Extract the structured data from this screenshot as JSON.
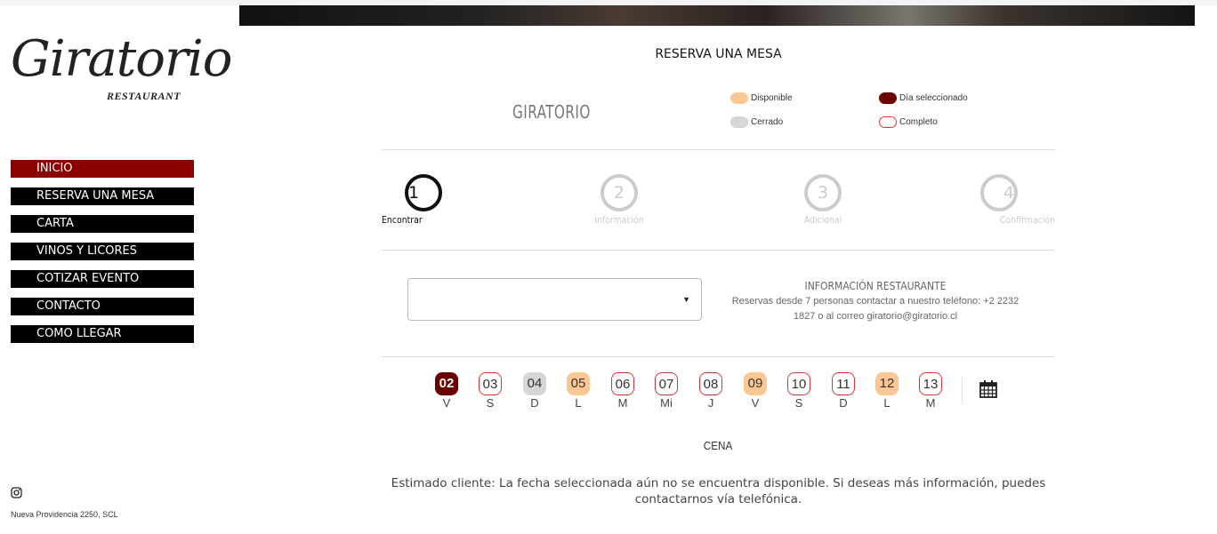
{
  "logo": {
    "script": "Giratorio",
    "subtitle": "RESTAURANT"
  },
  "nav": [
    {
      "label": "INICIO",
      "active": true
    },
    {
      "label": "RESERVA UNA MESA",
      "active": false
    },
    {
      "label": "CARTA",
      "active": false
    },
    {
      "label": "VINOS Y LICORES",
      "active": false
    },
    {
      "label": "COTIZAR EVENTO",
      "active": false
    },
    {
      "label": "CONTACTO",
      "active": false
    },
    {
      "label": "COMO LLEGAR",
      "active": false
    }
  ],
  "footer": {
    "address": "Nueva Providencia 2250, SCL",
    "social_icon": "instagram-icon"
  },
  "booking": {
    "title": "RESERVA UNA MESA",
    "restaurant_name": "GIRATORIO",
    "legend": {
      "available": "Disponible",
      "closed": "Cerrado",
      "selected": "Día seleccionado",
      "full": "Completo"
    },
    "steps": [
      {
        "num": "1",
        "label": "Encontrar"
      },
      {
        "num": "2",
        "label": "Información"
      },
      {
        "num": "3",
        "label": "Adicional"
      },
      {
        "num": "4",
        "label": "Confirmación"
      }
    ],
    "select_value": "",
    "info_title": "INFORMACIÓN RESTAURANTE",
    "info_text": "Reservas desde 7 personas contactar a nuestro teléfono: +2 2232 1827 o al correo giratorio@giratorio.cl",
    "days": [
      {
        "num": "02",
        "wd": "V",
        "state": "sel"
      },
      {
        "num": "03",
        "wd": "S",
        "state": "full"
      },
      {
        "num": "04",
        "wd": "D",
        "state": "closed"
      },
      {
        "num": "05",
        "wd": "L",
        "state": "avail"
      },
      {
        "num": "06",
        "wd": "M",
        "state": "full"
      },
      {
        "num": "07",
        "wd": "Mi",
        "state": "full"
      },
      {
        "num": "08",
        "wd": "J",
        "state": "full"
      },
      {
        "num": "09",
        "wd": "V",
        "state": "avail"
      },
      {
        "num": "10",
        "wd": "S",
        "state": "full"
      },
      {
        "num": "11",
        "wd": "D",
        "state": "full"
      },
      {
        "num": "12",
        "wd": "L",
        "state": "avail"
      },
      {
        "num": "13",
        "wd": "M",
        "state": "full"
      }
    ],
    "service": "CENA",
    "message": "Estimado cliente: La fecha seleccionada aún no se encuentra disponible. Si deseas más información, puedes contactarnos vía telefónica."
  },
  "colors": {
    "active_nav": "#8b0000",
    "selected_day": "#6b0000",
    "available_day": "#fbc793",
    "closed_day": "#d6d6d6",
    "full_border": "#dd3333"
  }
}
